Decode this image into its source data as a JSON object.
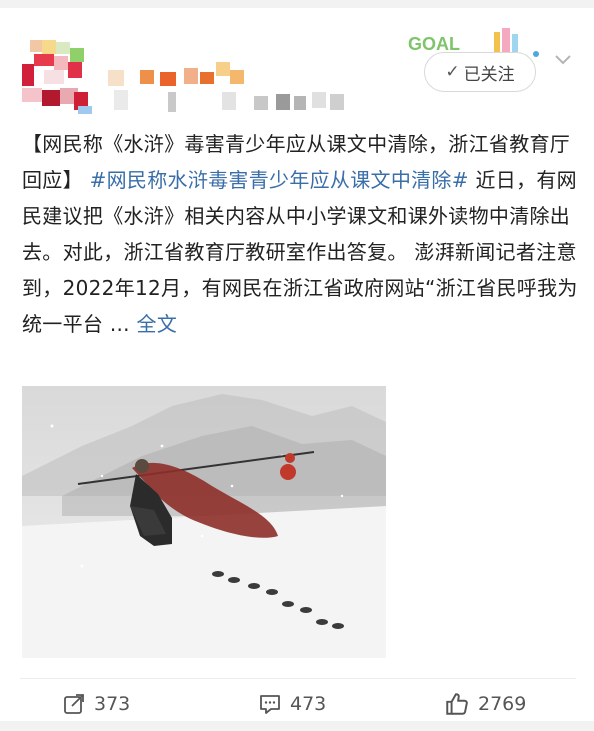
{
  "header": {
    "follow_label": "已关注",
    "badge_text": "GOAL"
  },
  "post": {
    "title": "【网民称《水浒》毒害青少年应从课文中清除，浙江省教育厅回应】",
    "hashtag": "#网民称水浒毒害青少年应从课文中清除#",
    "body": "近日，有网民建议把《水浒》相关内容从中小学课文和课外读物中清除出去。对此，浙江省教育厅教研室作出答复。 澎湃新闻记者注意到，2022年12月，有网民在浙江省政府网站“浙江省民呼我为统一平台 ...",
    "full_text_link": "全文"
  },
  "image": {
    "icon": "ink-painting-figure-in-snow"
  },
  "actions": {
    "share_count": "373",
    "comment_count": "473",
    "like_count": "2769"
  },
  "colors": {
    "link": "#3a6ea8",
    "text": "#222222",
    "muted": "#555555"
  }
}
